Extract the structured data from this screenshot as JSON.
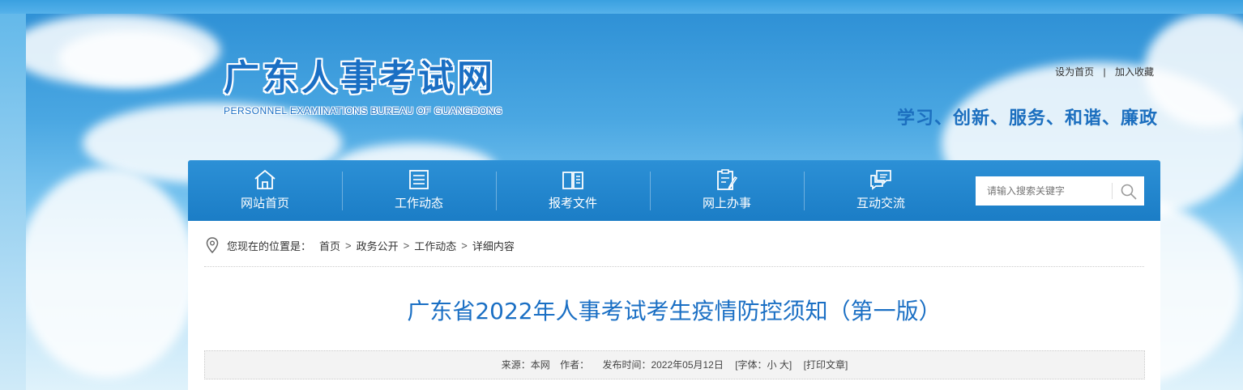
{
  "site": {
    "title_cn": "广东人事考试网",
    "title_en": "PERSONNEL EXAMINATIONS BUREAU OF GUANGDONG",
    "slogan": "学习、创新、服务、和谐、廉政"
  },
  "top_links": {
    "set_home": "设为首页",
    "separator": "|",
    "add_favorite": "加入收藏"
  },
  "nav": {
    "items": [
      {
        "label": "网站首页",
        "icon": "home-icon"
      },
      {
        "label": "工作动态",
        "icon": "document-list-icon"
      },
      {
        "label": "报考文件",
        "icon": "open-book-icon"
      },
      {
        "label": "网上办事",
        "icon": "clipboard-pen-icon"
      },
      {
        "label": "互动交流",
        "icon": "chat-bubbles-icon"
      }
    ]
  },
  "search": {
    "placeholder": "请输入搜索关键字",
    "icon": "search-icon"
  },
  "breadcrumb": {
    "prefix": "您现在的位置是：",
    "items": [
      "首页",
      "政务公开",
      "工作动态",
      "详细内容"
    ],
    "separator": ">"
  },
  "article": {
    "title": "广东省2022年人事考试考生疫情防控须知（第一版）",
    "source_label": "来源：",
    "source_value": "本网",
    "author_label": "作者：",
    "date_label": "发布时间：",
    "date_value": "2022年05月12日",
    "font_label": "[字体：",
    "font_small": "小",
    "font_large": "大",
    "font_close": "]",
    "print_label": "[打印文章]"
  },
  "colors": {
    "brand_blue": "#1a6fc4",
    "nav_blue": "#1f82ca",
    "info_bg": "#f3f3f3"
  }
}
